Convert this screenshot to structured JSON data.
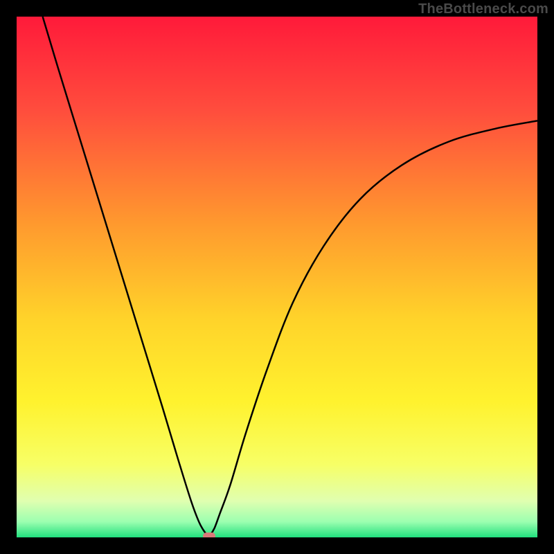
{
  "watermark": "TheBottleneck.com",
  "chart_data": {
    "type": "line",
    "title": "",
    "xlabel": "",
    "ylabel": "",
    "xlim": [
      0,
      100
    ],
    "ylim": [
      0,
      100
    ],
    "gradient_stops": [
      {
        "pos": 0.0,
        "color": "#ff1a3a"
      },
      {
        "pos": 0.18,
        "color": "#ff4d3d"
      },
      {
        "pos": 0.4,
        "color": "#ff9a2e"
      },
      {
        "pos": 0.58,
        "color": "#ffd32a"
      },
      {
        "pos": 0.74,
        "color": "#fff22e"
      },
      {
        "pos": 0.86,
        "color": "#f7ff66"
      },
      {
        "pos": 0.93,
        "color": "#e0ffb0"
      },
      {
        "pos": 0.97,
        "color": "#9cffb0"
      },
      {
        "pos": 1.0,
        "color": "#21e07e"
      }
    ],
    "series": [
      {
        "name": "bottleneck-curve",
        "x": [
          5.0,
          8.0,
          12.0,
          16.0,
          20.0,
          24.0,
          28.0,
          31.0,
          33.5,
          35.0,
          36.0,
          36.8,
          37.2,
          38.0,
          39.0,
          41.0,
          44.0,
          48.0,
          53.0,
          59.0,
          66.0,
          74.0,
          83.0,
          92.0,
          100.0
        ],
        "y": [
          100.0,
          90.0,
          77.0,
          64.0,
          51.0,
          38.0,
          25.0,
          15.0,
          7.0,
          3.0,
          1.2,
          0.3,
          0.5,
          1.8,
          4.5,
          10.0,
          20.0,
          32.0,
          45.0,
          56.0,
          65.0,
          71.5,
          76.0,
          78.5,
          80.0
        ]
      }
    ],
    "minimum_point": {
      "x": 37.0,
      "y": 0.3
    },
    "marker_color": "#d97a7a"
  }
}
